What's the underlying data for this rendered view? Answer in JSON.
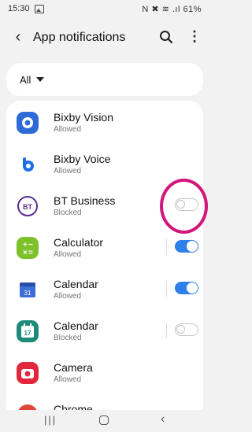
{
  "status_bar": {
    "time": "15:30",
    "right_text": "N ✖ ≋ .ıl 61%"
  },
  "app_bar": {
    "title": "App notifications",
    "back_icon": "back-arrow-icon",
    "search_icon": "search-icon",
    "more_icon": "more-vert-icon"
  },
  "filter": {
    "label": "All"
  },
  "apps": [
    {
      "name": "Bixby Vision",
      "status": "Allowed",
      "color": "#2e6bd6"
    },
    {
      "name": "Bixby Voice",
      "status": "Allowed",
      "color": "#1c6ee8"
    },
    {
      "name": "BT Business",
      "status": "Blocked",
      "color": "#5a2d91"
    },
    {
      "name": "Calculator",
      "status": "Allowed",
      "color": "#7dc12b"
    },
    {
      "name": "Calendar",
      "status": "Allowed",
      "color": "#3b6fd6"
    },
    {
      "name": "Calendar",
      "status": "Blocked",
      "color": "#1e8a7a"
    },
    {
      "name": "Camera",
      "status": "Allowed",
      "color": "#e2263d"
    },
    {
      "name": "Chrome",
      "status": "",
      "color": "#e0453a"
    }
  ],
  "toggles": {
    "bt_business": "off",
    "calculator": "on",
    "calendar_1": "on",
    "calendar_2": "off"
  },
  "colors": {
    "accent_blue": "#2f7fe8",
    "highlight_circle": "#d4157b"
  },
  "nav_bar": {
    "recent_icon": "recent-apps-icon",
    "home_icon": "home-icon",
    "back_icon": "back-icon"
  }
}
